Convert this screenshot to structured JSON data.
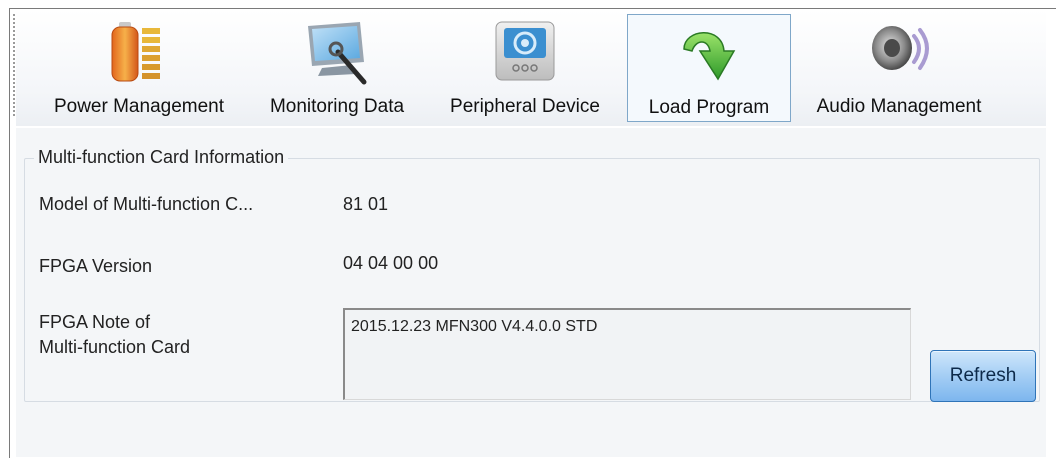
{
  "toolbar": {
    "items": [
      {
        "label": "Power Management",
        "icon": "battery-icon"
      },
      {
        "label": "Monitoring Data",
        "icon": "monitor-icon"
      },
      {
        "label": "Peripheral Device",
        "icon": "device-icon"
      },
      {
        "label": "Load Program",
        "icon": "green-arrow-icon",
        "active": true
      },
      {
        "label": "Audio Management",
        "icon": "speaker-icon"
      }
    ]
  },
  "card_info": {
    "group_title": "Multi-function Card Information",
    "model_label": "Model of Multi-function C...",
    "model_value": "81 01",
    "fpga_version_label": "FPGA Version",
    "fpga_version_value": "04 04 00 00",
    "fpga_note_label_line1": "FPGA Note of",
    "fpga_note_label_line2": "Multi-function Card",
    "fpga_note_value": "2015.12.23 MFN300 V4.4.0.0 STD",
    "refresh_label": "Refresh"
  },
  "colors": {
    "active_border": "#7fa7c9",
    "refresh_button": "#7db6ee",
    "panel_bg": "#f4f6f8"
  }
}
